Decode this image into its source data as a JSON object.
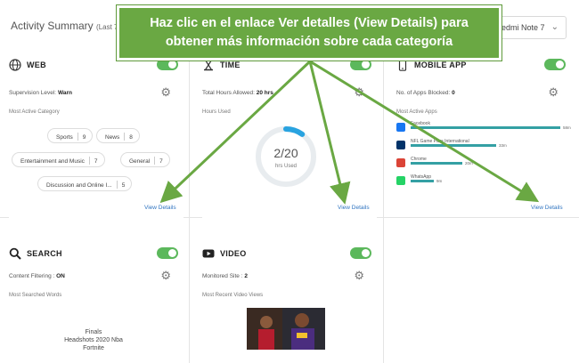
{
  "header": {
    "title": "Activity Summary",
    "subtitle": "(Last 7",
    "device": "edmi Note 7"
  },
  "callout": {
    "line1": "Haz clic en el enlace Ver detalles (View Details) para",
    "line2": "obtener más información sobre cada categoría"
  },
  "web": {
    "title": "WEB",
    "supervision_label": "Supervision Level:",
    "supervision_value": "Warn",
    "section_label": "Most Active Category",
    "categories": [
      {
        "name": "Sports",
        "count": "9"
      },
      {
        "name": "News",
        "count": "8"
      },
      {
        "name": "Entertainment and Music",
        "count": "7"
      },
      {
        "name": "General",
        "count": "7"
      },
      {
        "name": "Discussion and Online I...",
        "count": "5"
      }
    ],
    "view_details": "View Details"
  },
  "time": {
    "title": "TIME",
    "allowed_label": "Total Hours Allowed:",
    "allowed_value": "20 hrs",
    "section_label": "Hours Used",
    "used": "2/20",
    "used_unit": "hrs Used",
    "used_fraction": 0.1,
    "view_details": "View Details"
  },
  "mobile": {
    "title": "MOBILE APP",
    "blocked_label": "No. of Apps Blocked:",
    "blocked_value": "0",
    "section_label": "Most Active Apps",
    "apps": [
      {
        "name": "Facebook",
        "time": "58m",
        "minutes": 58,
        "icon": "facebook-icon",
        "color": "#1877f2"
      },
      {
        "name": "NFL Game Pass International",
        "time": "33m",
        "minutes": 33,
        "icon": "nfl-icon",
        "color": "#013369"
      },
      {
        "name": "Chrome",
        "time": "20m",
        "minutes": 20,
        "icon": "chrome-icon",
        "color": "#db4437"
      },
      {
        "name": "WhatsApp",
        "time": "9m",
        "minutes": 9,
        "icon": "whatsapp-icon",
        "color": "#25d366"
      }
    ],
    "view_details": "View Details"
  },
  "search": {
    "title": "SEARCH",
    "filter_label": "Content Filtering :",
    "filter_value": "ON",
    "section_label": "Most Searched Words",
    "word1": "Finals",
    "word2": "Headshots 2020 Nba",
    "word3": "Fortnite"
  },
  "video": {
    "title": "VIDEO",
    "monitored_label": "Monitored Site :",
    "monitored_value": "2",
    "section_label": "Most Recent Video Views"
  },
  "colors": {
    "accent_green": "#5cb85c",
    "callout_green": "#6aa843",
    "link_blue": "#2f74c0",
    "bar_teal": "#34a0a4"
  }
}
